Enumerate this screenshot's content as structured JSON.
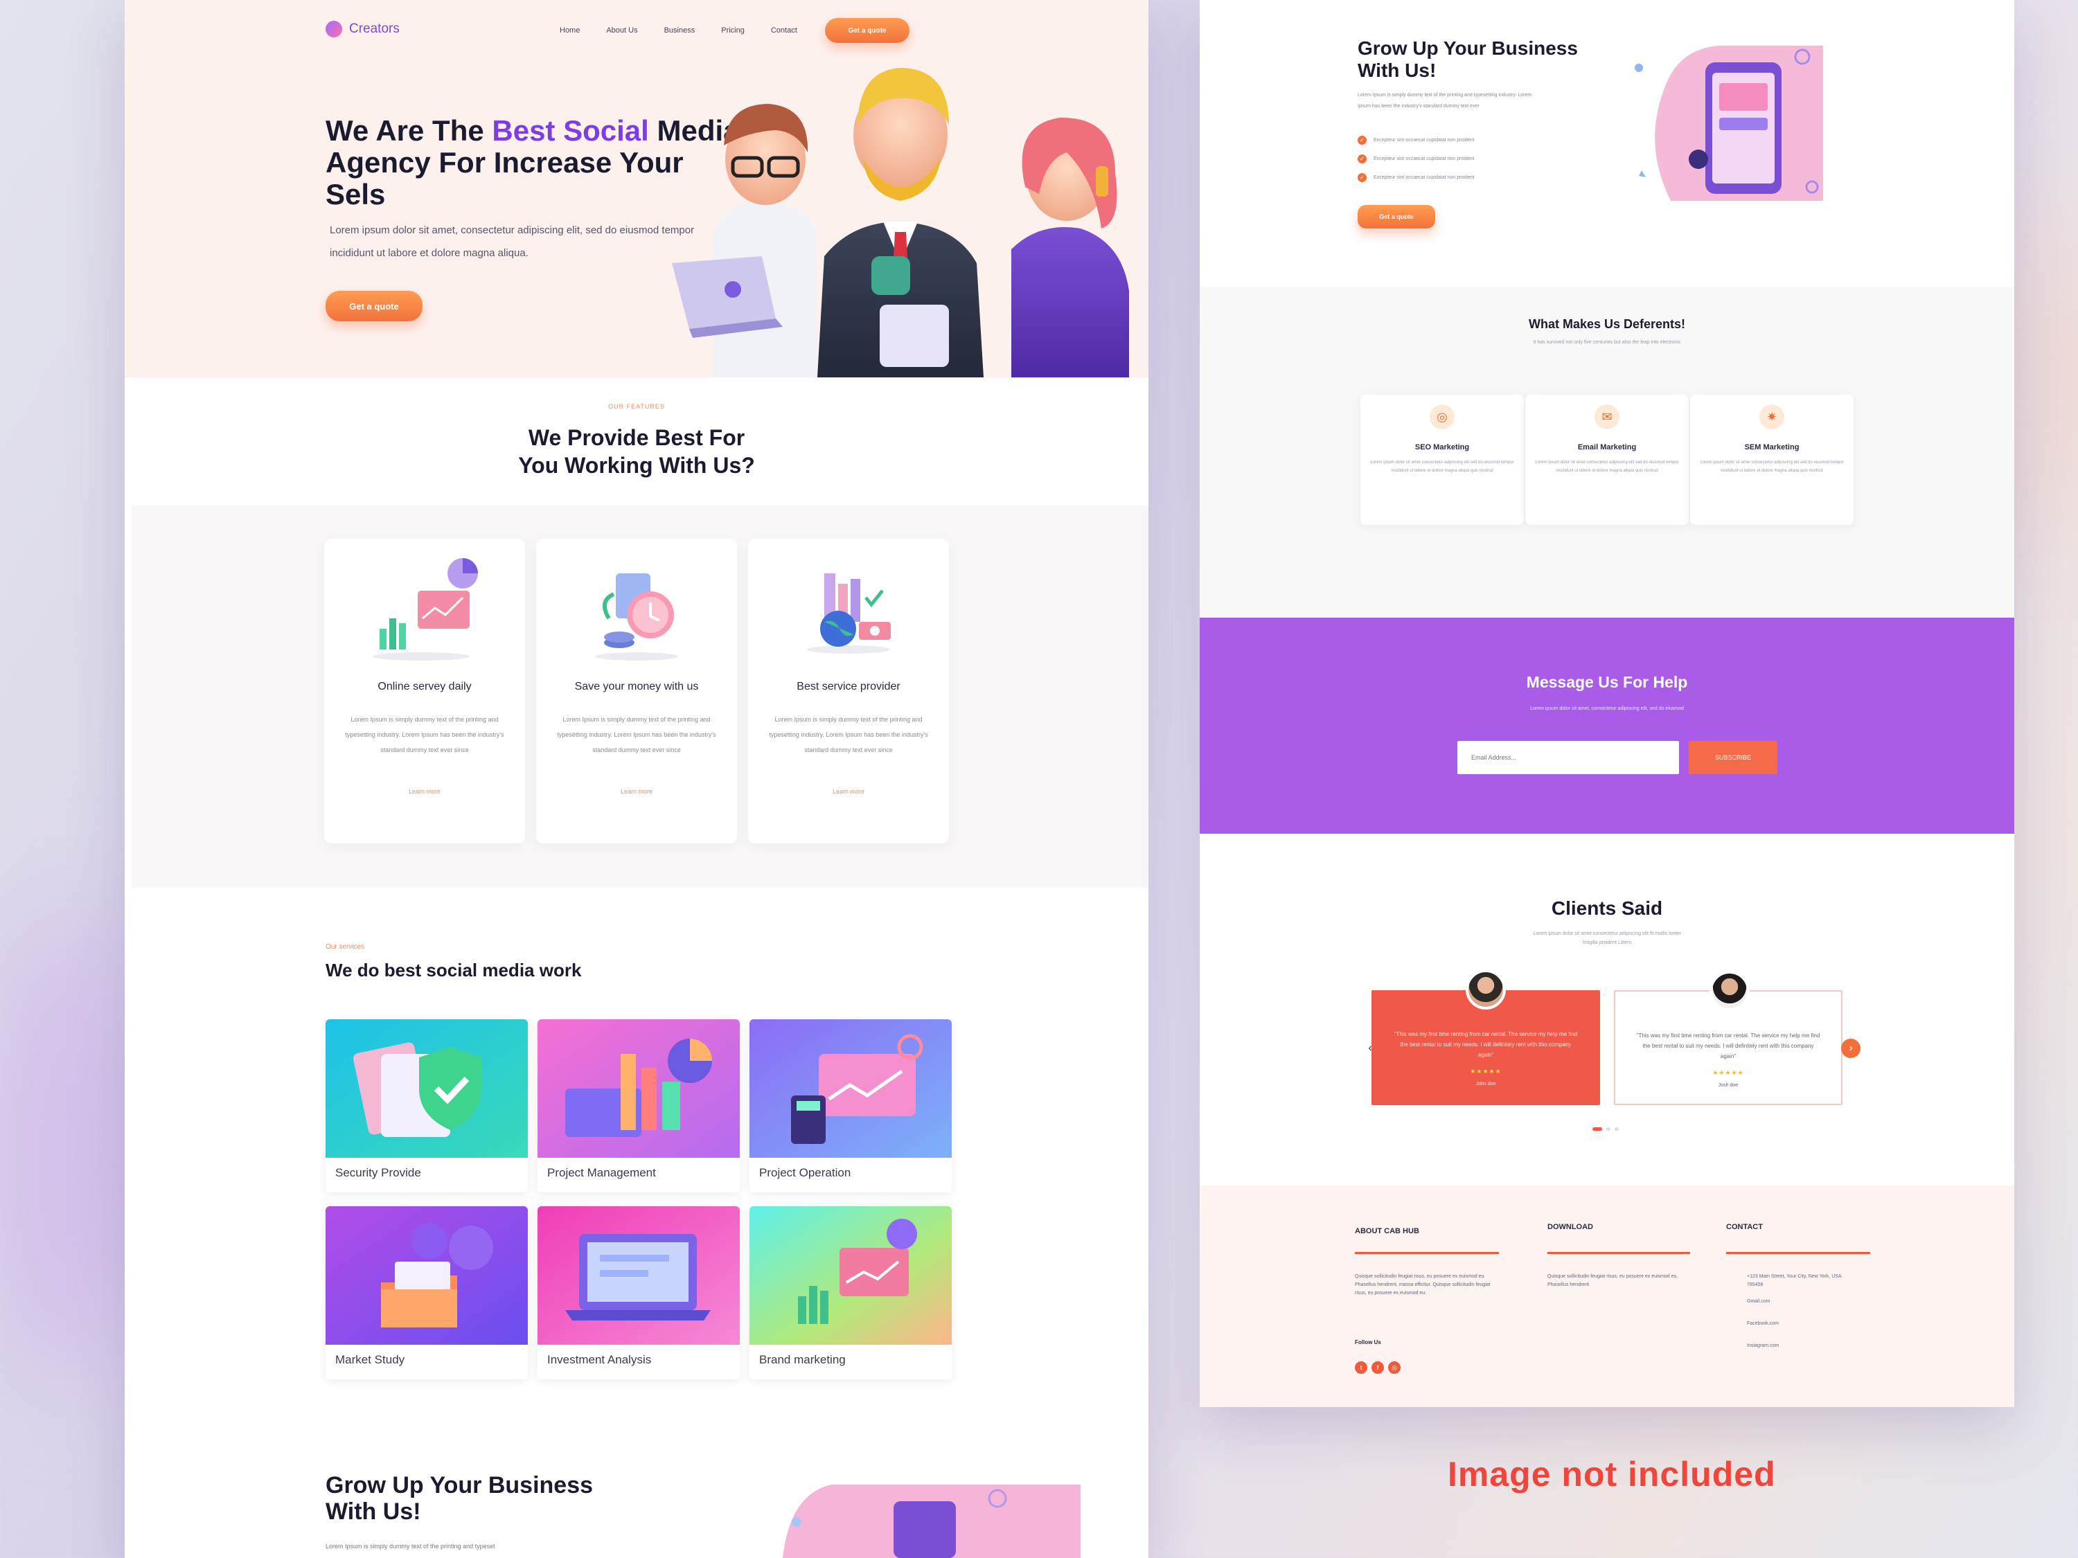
{
  "brand": {
    "name": "Creators"
  },
  "nav": {
    "items": [
      "Home",
      "About Us",
      "Business",
      "Pricing",
      "Contact"
    ],
    "cta": "Get a quote"
  },
  "hero": {
    "title_pre": "We Are The ",
    "title_accent": "Best Social",
    "title_post": "Media Agency For Increase Your Sels",
    "text": "Lorem ipsum dolor sit amet, consectetur adipiscing elit, sed do eiusmod tempor incididunt ut labore et dolore magna aliqua.",
    "cta": "Get a quote"
  },
  "features": {
    "tag": "OUR FEATURES",
    "title": "We Provide  Best  For You Working With Us?",
    "cards": [
      {
        "title": "Online servey daily",
        "text": "Lorem Ipsum is simply dummy text of the printing and typesetting industry. Lorem Ipsum has been the industry's standard dummy text ever since",
        "link": "Learn more",
        "icon": "chart-board-illustration"
      },
      {
        "title": "Save your money with us",
        "text": "Lorem Ipsum is simply dummy text of the printing and typesetting industry. Lorem Ipsum has been the industry's standard dummy text ever since",
        "link": "Learn more",
        "icon": "clock-money-illustration"
      },
      {
        "title": "Best service provider",
        "text": "Lorem Ipsum is simply dummy text of the printing and typesetting industry. Lorem Ipsum has been the industry's standard dummy text ever since",
        "link": "Learn more",
        "icon": "globe-city-illustration"
      }
    ]
  },
  "services": {
    "tag": "Our services",
    "title": "We do best social media work",
    "cards": [
      {
        "label": "Security Provide",
        "icon": "shield-check-illustration"
      },
      {
        "label": "Project Management",
        "icon": "bar-pie-illustration"
      },
      {
        "label": "Project Operation",
        "icon": "calculator-chart-illustration"
      },
      {
        "label": "Market Study",
        "icon": "gear-folder-illustration"
      },
      {
        "label": "Investment Analysis",
        "icon": "laptop-illustration"
      },
      {
        "label": "Brand marketing",
        "icon": "presentation-illustration"
      }
    ]
  },
  "grow_left": {
    "title": "Grow Up Your Business With Us!",
    "text": "Lorem Ipsum is simply dummy text of the printing and typeset"
  },
  "grow_right": {
    "title": "Grow Up Your Business With Us!",
    "text": "Lorem Ipsum is simply dummy text of the printing and typesetting industry. Lorem Ipsum has been the industry's standard dummy text ever",
    "checks": [
      "Excepteur sint occaecat cupidatat non proident",
      "Excepteur sint occaecat cupidatat non proident",
      "Excepteur sint occaecat cupidatat non proident"
    ],
    "cta": "Get a quote"
  },
  "different": {
    "title": "What Makes Us Deferents!",
    "subtitle": "It has survived not only five centuries but also the leap into electronic",
    "cards": [
      {
        "title": "SEO Marketing",
        "text": "Lorem ipsum dolor sit amet consectetur adipiscing elit sed do eiusmod tempor incididunt ut labore et dolore magna aliqua quis nostrud",
        "icon": "target-icon"
      },
      {
        "title": "Email Marketing",
        "text": "Lorem ipsum dolor sit amet consectetur adipiscing elit sed do eiusmod tempor incididunt ut labore et dolore magna aliqua quis nostrud",
        "icon": "mail-icon"
      },
      {
        "title": "SEM Marketing",
        "text": "Lorem ipsum dolor sit amet consectetur adipiscing elit sed do eiusmod tempor incididunt ut labore et dolore magna aliqua quis nostrud",
        "icon": "megaphone-icon"
      }
    ]
  },
  "message": {
    "title": "Message Us For Help",
    "subtitle": "Lorem ipsum dolor sit amet, consectetur adipiscing elit, sed do eiusmod",
    "placeholder": "Email Address...",
    "button": "SUBSCRIBE"
  },
  "clients": {
    "title": "Clients Said",
    "subtitle": "Lorem ipsum dolor sit amet consectetur adipiscing elit fit mollis lorem fringilla proident Libero",
    "testimonials": [
      {
        "quote": "\"This was my first time renting from car rental. The service my help me find the best rental to suit my needs. I will definitely rent with this company again\"",
        "stars": "★★★★★",
        "name": "John doe"
      },
      {
        "quote": "\"This was my first time renting from car rental. The service my help me find the best rental to suit my needs. I will definitely rent with this company again\"",
        "stars": "★★★★★",
        "name": "Josh doe"
      }
    ],
    "prev": "‹",
    "next": "›"
  },
  "footer": {
    "about_title": "ABOUT CAB HUB",
    "about_text": "Quisque sollicitudin feugiat risus, eu posuere ex euismod eu. Phasellus hendrerit, massa efficitur. Quisque sollicitudin feugiat risus, eu posuere ex euismod eu.",
    "follow": "Follow Us",
    "download_title": "DOWNLOAD",
    "download_text": "Quisque sollicitudin feugiat risus, eu posuere ex euismod eu. Phasellus hendrerit.",
    "contact_title": "CONTACT",
    "contact_address": "+123 Main Street, Your City, New York, USA 785456",
    "contact_links": [
      "Gmail.com",
      "Facebook.com",
      "Instagram.com"
    ]
  },
  "note": "Image not included",
  "colors": {
    "accent": "#7c3de6",
    "orange": "#f2723b",
    "purple_band": "#a95ce8",
    "testimonial": "#f0594a"
  }
}
